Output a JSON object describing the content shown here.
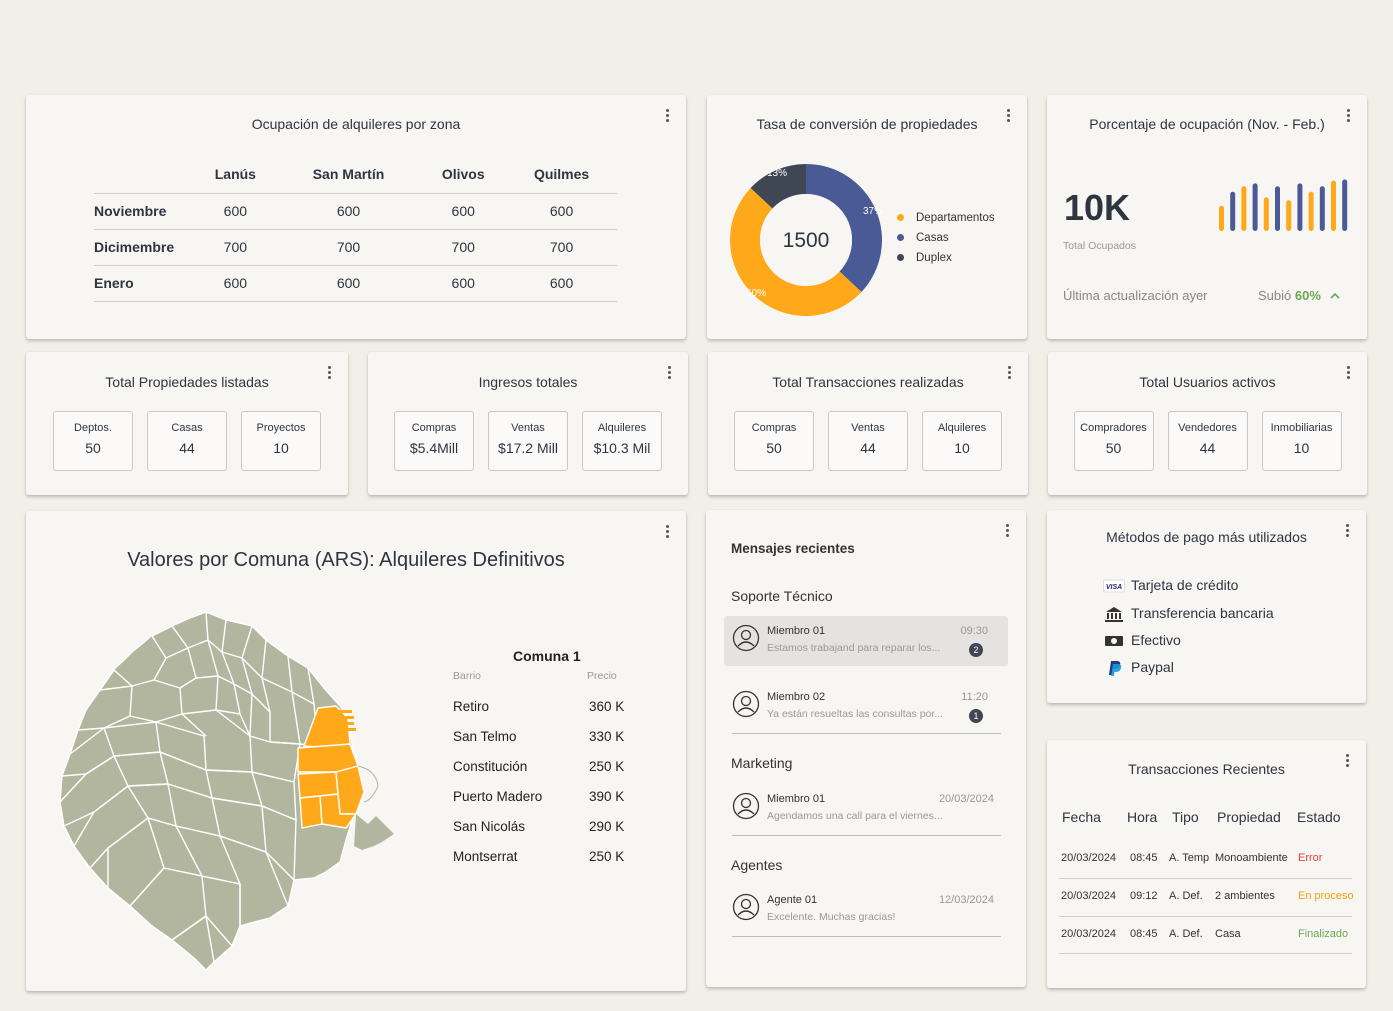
{
  "colors": {
    "accent_orange": "#ffa91a",
    "accent_blue": "#4a5a95",
    "dark": "#3f4654",
    "map_gray": "#b3b69f",
    "status_error": "#e0453a",
    "status_progress": "#f0a20c",
    "status_done": "#6aa84f",
    "up_green": "#6aa84f"
  },
  "occupancy": {
    "title": "Ocupación de alquileres por zona",
    "columns": [
      "Lanús",
      "San Martín",
      "Olivos",
      "Quilmes"
    ],
    "rows": [
      {
        "month": "Noviembre",
        "values": [
          "600",
          "600",
          "600",
          "600"
        ]
      },
      {
        "month": "Dicimembre",
        "values": [
          "700",
          "700",
          "700",
          "700"
        ]
      },
      {
        "month": "Enero",
        "values": [
          "600",
          "600",
          "600",
          "600"
        ]
      }
    ]
  },
  "conversion": {
    "title": "Tasa de conversión de propiedades",
    "center": "1500",
    "chart_data": {
      "type": "pie",
      "segments": [
        {
          "name": "Departamentos",
          "value": 50,
          "label": "50%",
          "color": "#ffa91a"
        },
        {
          "name": "Casas",
          "value": 37,
          "label": "37%",
          "color": "#4a5a95"
        },
        {
          "name": "Duplex",
          "value": 13,
          "label": "13%",
          "color": "#3f4654"
        }
      ]
    },
    "legend": [
      "Departamentos",
      "Casas",
      "Duplex"
    ]
  },
  "occupancy_pct": {
    "title": "Porcentaje de ocupación (Nov. - Feb.)",
    "big_value": "10K",
    "sub": "Total Ocupados",
    "updated": "Última actualización ayer",
    "trend_prefix": "Subió",
    "trend_value": "60%",
    "chart_data": {
      "type": "bar",
      "values": [
        45,
        70,
        80,
        85,
        60,
        80,
        55,
        85,
        70,
        80,
        90,
        92
      ],
      "colors": [
        "#ffa91a",
        "#4a5a95",
        "#ffa91a",
        "#4a5a95",
        "#ffa91a",
        "#4a5a95",
        "#ffa91a",
        "#4a5a95",
        "#ffa91a",
        "#4a5a95",
        "#ffa91a",
        "#4a5a95"
      ]
    }
  },
  "stat_cards": [
    {
      "title": "Total Propiedades listadas",
      "boxes": [
        {
          "label": "Deptos.",
          "value": "50"
        },
        {
          "label": "Casas",
          "value": "44"
        },
        {
          "label": "Proyectos",
          "value": "10"
        }
      ]
    },
    {
      "title": "Ingresos totales",
      "boxes": [
        {
          "label": "Compras",
          "value": "$5.4Mill"
        },
        {
          "label": "Ventas",
          "value": "$17.2 Mill"
        },
        {
          "label": "Alquileres",
          "value": "$10.3 Mil"
        }
      ]
    },
    {
      "title": "Total Transacciones realizadas",
      "boxes": [
        {
          "label": "Compras",
          "value": "50"
        },
        {
          "label": "Ventas",
          "value": "44"
        },
        {
          "label": "Alquileres",
          "value": "10"
        }
      ]
    },
    {
      "title": "Total Usuarios activos",
      "boxes": [
        {
          "label": "Compradores",
          "value": "50"
        },
        {
          "label": "Vendedores",
          "value": "44"
        },
        {
          "label": "Inmobiliarias",
          "value": "10"
        }
      ]
    }
  ],
  "map": {
    "title": "Valores por Comuna (ARS): Alquileres Definitivos",
    "comuna_title": "Comuna 1",
    "col_barrio": "Barrio",
    "col_precio": "Precio",
    "rows": [
      {
        "barrio": "Retiro",
        "precio": "360 K"
      },
      {
        "barrio": "San Telmo",
        "precio": "330 K"
      },
      {
        "barrio": "Constitución",
        "precio": "250 K"
      },
      {
        "barrio": "Puerto Madero",
        "precio": "390 K"
      },
      {
        "barrio": "San Nicolás",
        "precio": "290 K"
      },
      {
        "barrio": "Montserrat",
        "precio": "250 K"
      }
    ]
  },
  "messages": {
    "title": "Mensajes recientes",
    "sections": [
      {
        "name": "Soporte Técnico",
        "items": [
          {
            "name": "Miembro 01",
            "text": "Estamos trabajand para reparar los...",
            "time": "09:30",
            "badge": "2"
          },
          {
            "name": "Miembro 02",
            "text": "Ya están resueltas las consultas por...",
            "time": "11:20",
            "badge": "1"
          }
        ]
      },
      {
        "name": "Marketing",
        "items": [
          {
            "name": "Miembro 01",
            "text": "Agendamos una call para el viernes...",
            "time": "20/03/2024"
          }
        ]
      },
      {
        "name": "Agentes",
        "items": [
          {
            "name": "Agente 01",
            "text": "Excelente. Muchas gracias!",
            "time": "12/03/2024"
          }
        ]
      }
    ]
  },
  "payments": {
    "title": "Métodos de pago más utilizados",
    "items": [
      {
        "label": "Tarjeta de crédito",
        "icon": "visa-icon"
      },
      {
        "label": "Transferencia bancaria",
        "icon": "bank-icon"
      },
      {
        "label": "Efectivo",
        "icon": "cash-icon"
      },
      {
        "label": "Paypal",
        "icon": "paypal-icon"
      }
    ]
  },
  "transactions": {
    "title": "Transacciones Recientes",
    "columns": [
      "Fecha",
      "Hora",
      "Tipo",
      "Propiedad",
      "Estado"
    ],
    "rows": [
      {
        "fecha": "20/03/2024",
        "hora": "08:45",
        "tipo": "A. Temp",
        "propiedad": "Monoambiente",
        "estado": "Error",
        "status": "error"
      },
      {
        "fecha": "20/03/2024",
        "hora": "09:12",
        "tipo": "A. Def.",
        "propiedad": "2 ambientes",
        "estado": "En proceso",
        "status": "progress"
      },
      {
        "fecha": "20/03/2024",
        "hora": "08:45",
        "tipo": "A. Def.",
        "propiedad": "Casa",
        "estado": "Finalizado",
        "status": "done"
      }
    ]
  }
}
